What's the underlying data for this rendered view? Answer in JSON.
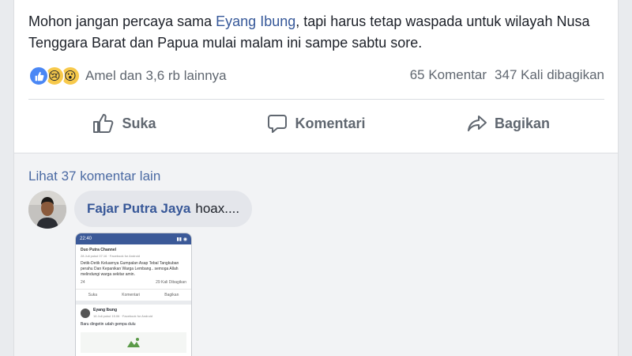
{
  "post": {
    "text_before_link": "Mohon jangan percaya sama ",
    "link_text": "Eyang Ibung",
    "text_after_link": ", tapi harus tetap waspada untuk wilayah Nusa Tenggara Barat dan Papua mulai malam ini sampe sabtu sore.",
    "reactions": {
      "icons": [
        "like-icon",
        "sad-icon",
        "wow-icon"
      ],
      "summary": "Amel dan 3,6 rb lainnya"
    },
    "comments_count": "65 Komentar",
    "shares_count": "347 Kali dibagikan",
    "actions": {
      "like": "Suka",
      "comment": "Komentari",
      "share": "Bagikan"
    }
  },
  "comments": {
    "more_link": "Lihat 37 komentar lain",
    "items": [
      {
        "author": "Fajar Putra Jaya",
        "text": "hoax...."
      }
    ]
  },
  "attachment": {
    "time": "22:40",
    "post1_author": "Duo Putra Channel",
    "post1_meta": "28 Juli pukul 07.16 · Facebook for Android",
    "post1_text": "Detik-Detik Keluarnya Gumpalan Asap Tebal Tangkuban perahu Dan Kepanikan Warga Lembang.. semoga Allah melindungi warga sekitar amin.",
    "post1_reactions": "24",
    "post1_shares": "29 Kali Dibagikan",
    "post1_actions": [
      "Suka",
      "Komentari",
      "Bagikan"
    ],
    "post2_author": "Eyang Ibung",
    "post2_meta": "16 Juli pukul 15.06 · Facebook for Android",
    "post2_text": "Baru dingetin udah gempa dulu"
  }
}
